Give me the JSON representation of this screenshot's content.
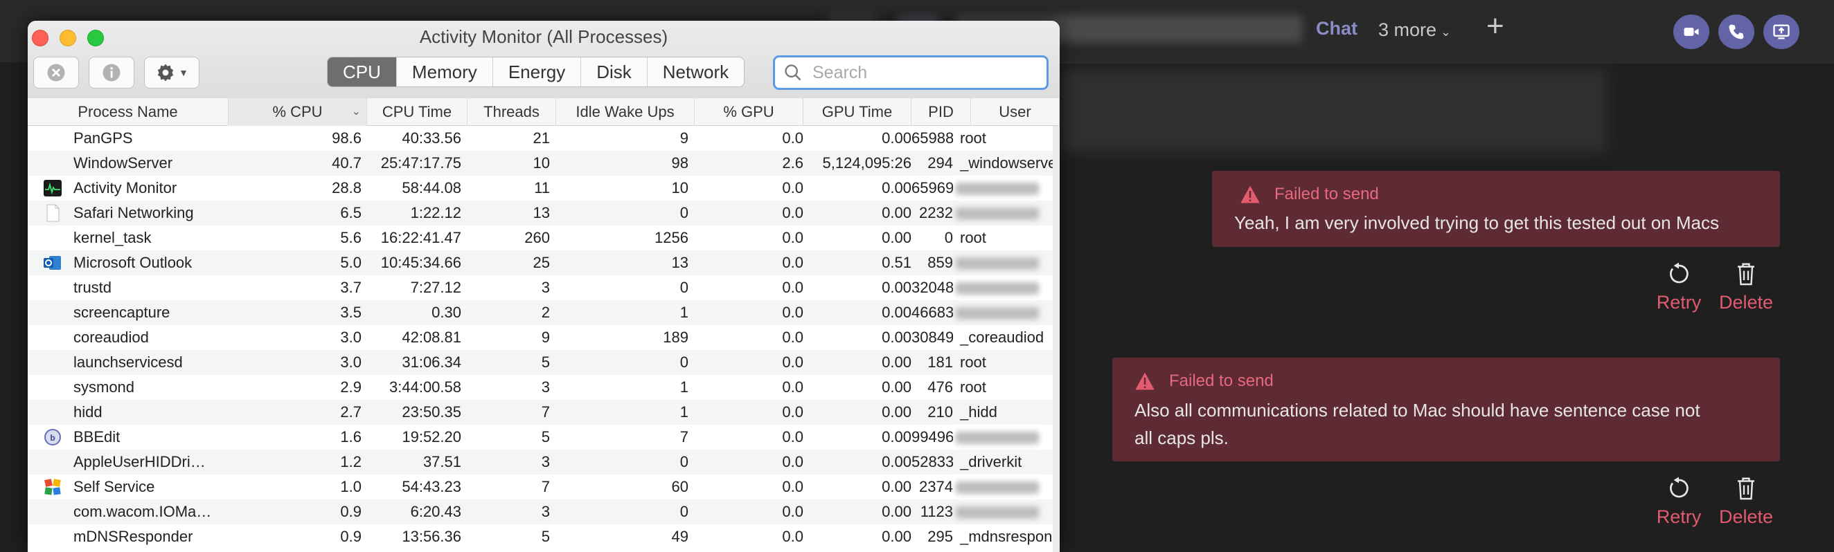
{
  "teams": {
    "chat_tab": "Chat",
    "more_tabs": "3 more",
    "add_tab_icon": "plus-icon",
    "header_buttons": [
      "video-call-icon",
      "audio-call-icon",
      "share-screen-icon"
    ],
    "messages": [
      {
        "status": "Failed to send",
        "text": [
          "Yeah, I am very involved trying to get this tested out on Macs"
        ],
        "retry_label": "Retry",
        "delete_label": "Delete"
      },
      {
        "status": "Failed to send",
        "text": [
          "Also all communications related to Mac should have sentence case not",
          "all caps pls."
        ],
        "retry_label": "Retry",
        "delete_label": "Delete"
      }
    ],
    "colors": {
      "accent": "#6264a7",
      "error_bubble": "#5e2a33",
      "error_text": "#e25b6e"
    }
  },
  "activity_monitor": {
    "title": "Activity Monitor (All Processes)",
    "toolbar": {
      "stop_icon": "stop-process-icon",
      "info_icon": "info-icon",
      "gear_icon": "gear-icon"
    },
    "tabs": [
      "CPU",
      "Memory",
      "Energy",
      "Disk",
      "Network"
    ],
    "active_tab": "CPU",
    "search_placeholder": "Search",
    "columns": [
      "Process Name",
      "% CPU",
      "CPU Time",
      "Threads",
      "Idle Wake Ups",
      "% GPU",
      "GPU Time",
      "PID",
      "User"
    ],
    "sorted_column": "% CPU",
    "rows": [
      {
        "name": "PanGPS",
        "cpu": "98.6",
        "cpu_time": "40:33.56",
        "threads": "21",
        "idle": "9",
        "gpu": "0.0",
        "gpu_time": "0.00",
        "pid": "65988",
        "user": "root",
        "icon": "none"
      },
      {
        "name": "WindowServer",
        "cpu": "40.7",
        "cpu_time": "25:47:17.75",
        "threads": "10",
        "idle": "98",
        "gpu": "2.6",
        "gpu_time": "5,124,095:26",
        "pid": "294",
        "user": "_windowserver",
        "icon": "none"
      },
      {
        "name": "Activity Monitor",
        "cpu": "28.8",
        "cpu_time": "58:44.08",
        "threads": "11",
        "idle": "10",
        "gpu": "0.0",
        "gpu_time": "0.00",
        "pid": "65969",
        "user": "",
        "icon": "activity-monitor-icon"
      },
      {
        "name": "Safari Networking",
        "cpu": "6.5",
        "cpu_time": "1:22.12",
        "threads": "13",
        "idle": "0",
        "gpu": "0.0",
        "gpu_time": "0.00",
        "pid": "2232",
        "user": "",
        "icon": "document-icon"
      },
      {
        "name": "kernel_task",
        "cpu": "5.6",
        "cpu_time": "16:22:41.47",
        "threads": "260",
        "idle": "1256",
        "gpu": "0.0",
        "gpu_time": "0.00",
        "pid": "0",
        "user": "root",
        "icon": "none"
      },
      {
        "name": "Microsoft Outlook",
        "cpu": "5.0",
        "cpu_time": "10:45:34.66",
        "threads": "25",
        "idle": "13",
        "gpu": "0.0",
        "gpu_time": "0.51",
        "pid": "859",
        "user": "",
        "icon": "outlook-icon"
      },
      {
        "name": "trustd",
        "cpu": "3.7",
        "cpu_time": "7:27.12",
        "threads": "3",
        "idle": "0",
        "gpu": "0.0",
        "gpu_time": "0.00",
        "pid": "32048",
        "user": "",
        "icon": "none"
      },
      {
        "name": "screencapture",
        "cpu": "3.5",
        "cpu_time": "0.30",
        "threads": "2",
        "idle": "1",
        "gpu": "0.0",
        "gpu_time": "0.00",
        "pid": "46683",
        "user": "",
        "icon": "none"
      },
      {
        "name": "coreaudiod",
        "cpu": "3.0",
        "cpu_time": "42:08.81",
        "threads": "9",
        "idle": "189",
        "gpu": "0.0",
        "gpu_time": "0.00",
        "pid": "30849",
        "user": "_coreaudiod",
        "icon": "none"
      },
      {
        "name": "launchservicesd",
        "cpu": "3.0",
        "cpu_time": "31:06.34",
        "threads": "5",
        "idle": "0",
        "gpu": "0.0",
        "gpu_time": "0.00",
        "pid": "181",
        "user": "root",
        "icon": "none"
      },
      {
        "name": "sysmond",
        "cpu": "2.9",
        "cpu_time": "3:44:00.58",
        "threads": "3",
        "idle": "1",
        "gpu": "0.0",
        "gpu_time": "0.00",
        "pid": "476",
        "user": "root",
        "icon": "none"
      },
      {
        "name": "hidd",
        "cpu": "2.7",
        "cpu_time": "23:50.35",
        "threads": "7",
        "idle": "1",
        "gpu": "0.0",
        "gpu_time": "0.00",
        "pid": "210",
        "user": "_hidd",
        "icon": "none"
      },
      {
        "name": "BBEdit",
        "cpu": "1.6",
        "cpu_time": "19:52.20",
        "threads": "5",
        "idle": "7",
        "gpu": "0.0",
        "gpu_time": "0.00",
        "pid": "99496",
        "user": "",
        "icon": "bbedit-icon"
      },
      {
        "name": "AppleUserHIDDri…",
        "cpu": "1.2",
        "cpu_time": "37.51",
        "threads": "3",
        "idle": "0",
        "gpu": "0.0",
        "gpu_time": "0.00",
        "pid": "52833",
        "user": "_driverkit",
        "icon": "none"
      },
      {
        "name": "Self Service",
        "cpu": "1.0",
        "cpu_time": "54:43.23",
        "threads": "7",
        "idle": "60",
        "gpu": "0.0",
        "gpu_time": "0.00",
        "pid": "2374",
        "user": "",
        "icon": "self-service-icon"
      },
      {
        "name": "com.wacom.IOMa…",
        "cpu": "0.9",
        "cpu_time": "6:20.43",
        "threads": "3",
        "idle": "0",
        "gpu": "0.0",
        "gpu_time": "0.00",
        "pid": "1123",
        "user": "",
        "icon": "none"
      },
      {
        "name": "mDNSResponder",
        "cpu": "0.9",
        "cpu_time": "13:56.36",
        "threads": "5",
        "idle": "49",
        "gpu": "0.0",
        "gpu_time": "0.00",
        "pid": "295",
        "user": "_mdnsrespond",
        "icon": "none"
      }
    ]
  }
}
